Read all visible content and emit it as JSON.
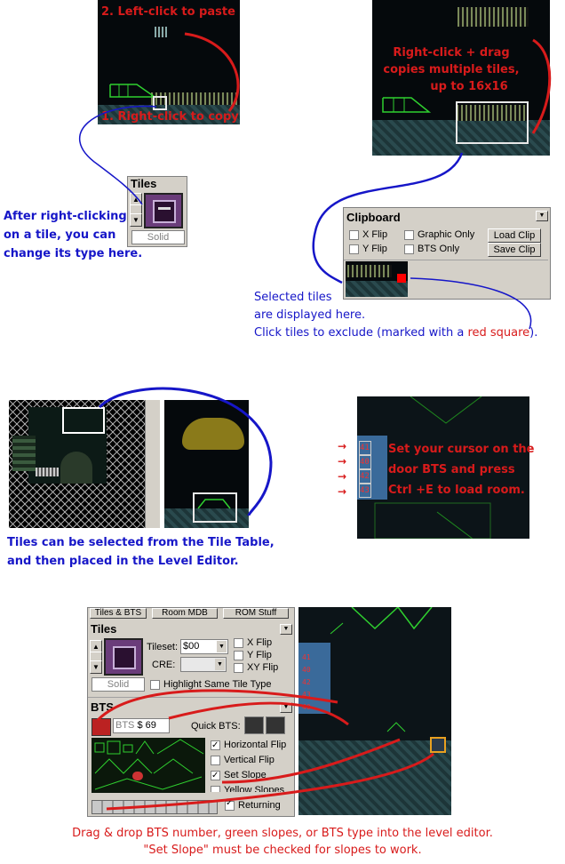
{
  "annotations": {
    "paste": "2. Left-click to paste",
    "copy": "1. Right-click to copy",
    "multi_line1": "Right-click + drag",
    "multi_line2": "copies multiple tiles,",
    "multi_line3": "up to 16x16",
    "change_line1": "After right-clicking",
    "change_line2": "on a tile, you can",
    "change_line3": "change its type here.",
    "selected_line1": "Selected tiles",
    "selected_line2": "are displayed here.",
    "selected_line3": "Click tiles to exclude (marked with a ",
    "selected_red": "red square",
    "selected_end": ").",
    "door_line1": "Set your cursor on the",
    "door_line2": "door BTS and press",
    "door_line3": "Ctrl +E to load room.",
    "tiletable_line1": "Tiles can be selected from the Tile Table,",
    "tiletable_line2": "and then placed in the Level Editor.",
    "dragdrop_line1": "Drag & drop BTS number, green slopes, or BTS type into the level editor.",
    "dragdrop_line2": "\"Set Slope\" must be checked for slopes to work."
  },
  "tiles_widget": {
    "title": "Tiles",
    "type_label": "Solid"
  },
  "clipboard": {
    "title": "Clipboard",
    "x_flip": "X Flip",
    "y_flip": "Y Flip",
    "graphic_only": "Graphic Only",
    "bts_only": "BTS Only",
    "load_clip": "Load Clip",
    "save_clip": "Save Clip"
  },
  "editor_panel": {
    "tabs": [
      "Tiles & BTS",
      "Room MDB",
      "ROM Stuff"
    ],
    "tiles_title": "Tiles",
    "tileset_label": "Tileset:",
    "tileset_value": "$00",
    "cre_label": "CRE:",
    "x_flip": "X Flip",
    "y_flip": "Y Flip",
    "xy_flip": "XY Flip",
    "type_label": "Solid",
    "highlight": "Highlight Same Tile Type",
    "bts_title": "BTS",
    "bts_label": "BTS",
    "bts_value": "$ 69",
    "quick_bts": "Quick BTS:",
    "horizontal_flip": "Horizontal Flip",
    "vertical_flip": "Vertical Flip",
    "set_slope": "Set Slope",
    "yellow_slopes": "Yellow Slopes",
    "returning": "Returning"
  },
  "door_bts": [
    "41",
    "40",
    "42",
    "43",
    "40"
  ],
  "editor_bts": [
    "41",
    "40",
    "42",
    "43",
    "40"
  ],
  "colors": {
    "red": "#d81b1b",
    "blue": "#1616c8",
    "slope_green": "#2fd02f",
    "panel_gray": "#d4d0c8"
  }
}
